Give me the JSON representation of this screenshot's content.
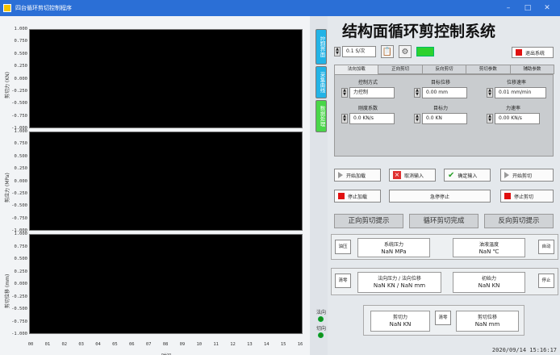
{
  "window": {
    "title": "四台循环剪切控制程序"
  },
  "system_title": "结构面循环剪控制系统",
  "charts": [
    {
      "ylabel": "剪切力 (KN)",
      "yticks": [
        "1.000",
        "0.750",
        "0.500",
        "0.250",
        "0.000",
        "-0.250",
        "-0.500",
        "-0.750",
        "-1.000"
      ]
    },
    {
      "ylabel": "剪应力 (MPa)",
      "yticks": [
        "1.000",
        "0.750",
        "0.500",
        "0.250",
        "0.000",
        "-0.250",
        "-0.500",
        "-0.750",
        "-1.000"
      ]
    },
    {
      "ylabel": "剪切位移 (mm)",
      "yticks": [
        "1.000",
        "0.750",
        "0.500",
        "0.250",
        "0.000",
        "-0.250",
        "-0.500",
        "-0.750",
        "-1.000"
      ]
    }
  ],
  "xaxis": {
    "label": "时间",
    "ticks": [
      "00",
      "01",
      "02",
      "03",
      "04",
      "05",
      "06",
      "07",
      "08",
      "09",
      "10",
      "11",
      "12",
      "13",
      "14",
      "15",
      "16"
    ]
  },
  "side_tabs": [
    {
      "label": "控制界面"
    },
    {
      "label": "采集曲线"
    },
    {
      "label": "数据处理"
    }
  ],
  "side_tab_colors": [
    "#22b3e6",
    "#22b3e6",
    "#49d649"
  ],
  "status": {
    "label_top": "法向",
    "label_bottom": "切向"
  },
  "top_controls": {
    "rate_value": "0.1 S/次",
    "exit_label": "退出系统"
  },
  "tabs": [
    "法向加载",
    "正向剪切",
    "反向剪切",
    "剪切参数",
    "辅助参数"
  ],
  "load_params": [
    {
      "label": "控制方式",
      "value": "力控制"
    },
    {
      "label": "目标位移",
      "value": "0.00 mm"
    },
    {
      "label": "位移速率",
      "value": "0.01 mm/min"
    },
    {
      "label": "刚度系数",
      "value": "0.0 KN/s"
    },
    {
      "label": "目标力",
      "value": "0.0 KN"
    },
    {
      "label": "力速率",
      "value": "0.00 KN/s"
    }
  ],
  "buttons": {
    "start_load": "开始加载",
    "cancel_load": "取消输入",
    "confirm_load": "确定输入",
    "start_shear": "开始剪切",
    "stop_load": "停止加载",
    "emergency_stop": "急停停止",
    "stop_shear": "停止剪切"
  },
  "mode_buttons": [
    "正向剪切提示",
    "循环剪切完成",
    "反向剪切提示"
  ],
  "readouts": {
    "hydraulic_btn": "油压",
    "pressure": {
      "label": "系统压力",
      "value": "NaN MPa"
    },
    "oil_temp": {
      "label": "油液温度",
      "value": "NaN ℃"
    },
    "stop_btn_1": "自动",
    "clear_btn": "清零",
    "normal": {
      "label": "法向压力  /  法向位移",
      "value": "NaN KN  /  NaN mm"
    },
    "initial_force": {
      "label": "初始力",
      "value": "NaN KN"
    },
    "stop_btn_2": "停止",
    "shear_force": {
      "label": "剪切力",
      "value": "NaN KN"
    },
    "zero_btn": "清零",
    "shear_disp": {
      "label": "剪切位移",
      "value": "NaN mm"
    }
  },
  "datetime": "2020/09/14 15:16:17"
}
